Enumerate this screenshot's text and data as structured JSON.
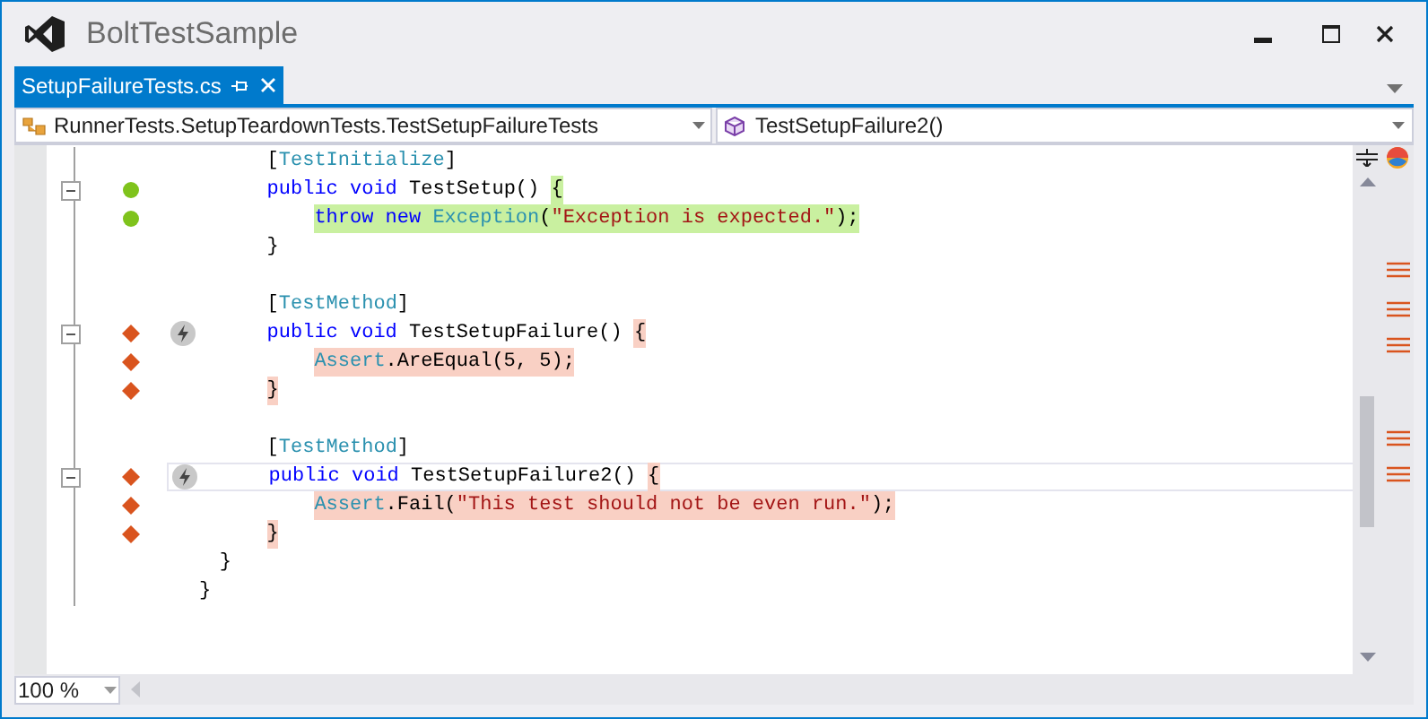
{
  "window": {
    "title": "BoltTestSample"
  },
  "tabs": [
    {
      "label": "SetupFailureTests.cs",
      "selected": true
    }
  ],
  "nav": {
    "type_combo": "RunnerTests.SetupTeardownTests.TestSetupFailureTests",
    "member_combo": "TestSetupFailure2()"
  },
  "code": [
    {
      "children": [
        {
          "children": [
            {
              "tokens": [
                {
                  "text": "[",
                  "kind": "plain"
                },
                {
                  "text": "TestInitialize",
                  "kind": "type"
                },
                {
                  "text": "]",
                  "kind": "plain"
                }
              ]
            },
            {
              "fold": {
                "expanded": true
              },
              "covered": true,
              "passed": true,
              "tokens": [
                {
                  "text": "public",
                  "kind": "keyword"
                },
                {
                  "text": " void",
                  "kind": "keyword"
                },
                {
                  "text": " TestSetup() ",
                  "kind": "plain"
                },
                {
                  "text": "{",
                  "kind": "plain",
                  "highlighted": true
                }
              ],
              "children": [
                {
                  "covered": true,
                  "passed": true,
                  "tokens": [
                    {
                      "text": "throw",
                      "kind": "keyword",
                      "highlighted": true
                    },
                    {
                      "text": " new",
                      "kind": "keyword",
                      "highlighted": true
                    },
                    {
                      "text": " Exception",
                      "kind": "type",
                      "highlighted": true
                    },
                    {
                      "text": "(",
                      "kind": "plain",
                      "highlighted": true
                    },
                    {
                      "text": "\"Exception is expected.\"",
                      "kind": "string",
                      "highlighted": true
                    },
                    {
                      "text": ");",
                      "kind": "plain",
                      "highlighted": true
                    }
                  ]
                }
              ]
            },
            {
              "tokens": [
                {
                  "text": "}",
                  "kind": "plain"
                }
              ]
            },
            {
              "blank": true
            },
            {
              "tokens": [
                {
                  "text": "[",
                  "kind": "plain"
                },
                {
                  "text": "TestMethod",
                  "kind": "type"
                },
                {
                  "text": "]",
                  "kind": "plain"
                }
              ]
            },
            {
              "fold": {
                "expanded": true
              },
              "covered": true,
              "passed": false,
              "glyph": true,
              "tokens": [
                {
                  "text": "public",
                  "kind": "keyword"
                },
                {
                  "text": " void",
                  "kind": "keyword"
                },
                {
                  "text": " TestSetupFailure() ",
                  "kind": "plain"
                },
                {
                  "text": "{",
                  "kind": "plain",
                  "highlighted": true
                }
              ],
              "children": [
                {
                  "covered": true,
                  "passed": false,
                  "tokens": [
                    {
                      "text": "Assert",
                      "kind": "type",
                      "highlighted": true
                    },
                    {
                      "text": ".AreEqual(5, 5);",
                      "kind": "plain",
                      "highlighted": true
                    }
                  ]
                }
              ]
            },
            {
              "covered": true,
              "passed": false,
              "tokens": [
                {
                  "text": "}",
                  "kind": "plain",
                  "highlighted": true
                }
              ]
            },
            {
              "blank": true
            },
            {
              "tokens": [
                {
                  "text": "[",
                  "kind": "plain"
                },
                {
                  "text": "TestMethod",
                  "kind": "type"
                },
                {
                  "text": "]",
                  "kind": "plain"
                }
              ]
            },
            {
              "fold": {
                "expanded": true
              },
              "covered": true,
              "passed": false,
              "glyph": true,
              "current": true,
              "tokens": [
                {
                  "text": "public",
                  "kind": "keyword"
                },
                {
                  "text": " void",
                  "kind": "keyword"
                },
                {
                  "text": " TestSetupFailure2() ",
                  "kind": "plain"
                },
                {
                  "text": "{",
                  "kind": "plain",
                  "highlighted": true
                }
              ],
              "children": [
                {
                  "covered": true,
                  "passed": false,
                  "tokens": [
                    {
                      "text": "Assert",
                      "kind": "type",
                      "highlighted": true
                    },
                    {
                      "text": ".Fail(",
                      "kind": "plain",
                      "highlighted": true
                    },
                    {
                      "text": "\"This test should not be even run.\"",
                      "kind": "string",
                      "highlighted": true
                    },
                    {
                      "text": ");",
                      "kind": "plain",
                      "highlighted": true
                    }
                  ]
                }
              ]
            },
            {
              "covered": true,
              "passed": false,
              "tokens": [
                {
                  "text": "}",
                  "kind": "plain",
                  "highlighted": true
                }
              ]
            }
          ]
        },
        {
          "tokens": [
            {
              "text": "}",
              "kind": "plain"
            }
          ]
        }
      ]
    },
    {
      "tokens": [
        {
          "text": "}",
          "kind": "plain"
        }
      ]
    }
  ],
  "zoom": "100 %"
}
